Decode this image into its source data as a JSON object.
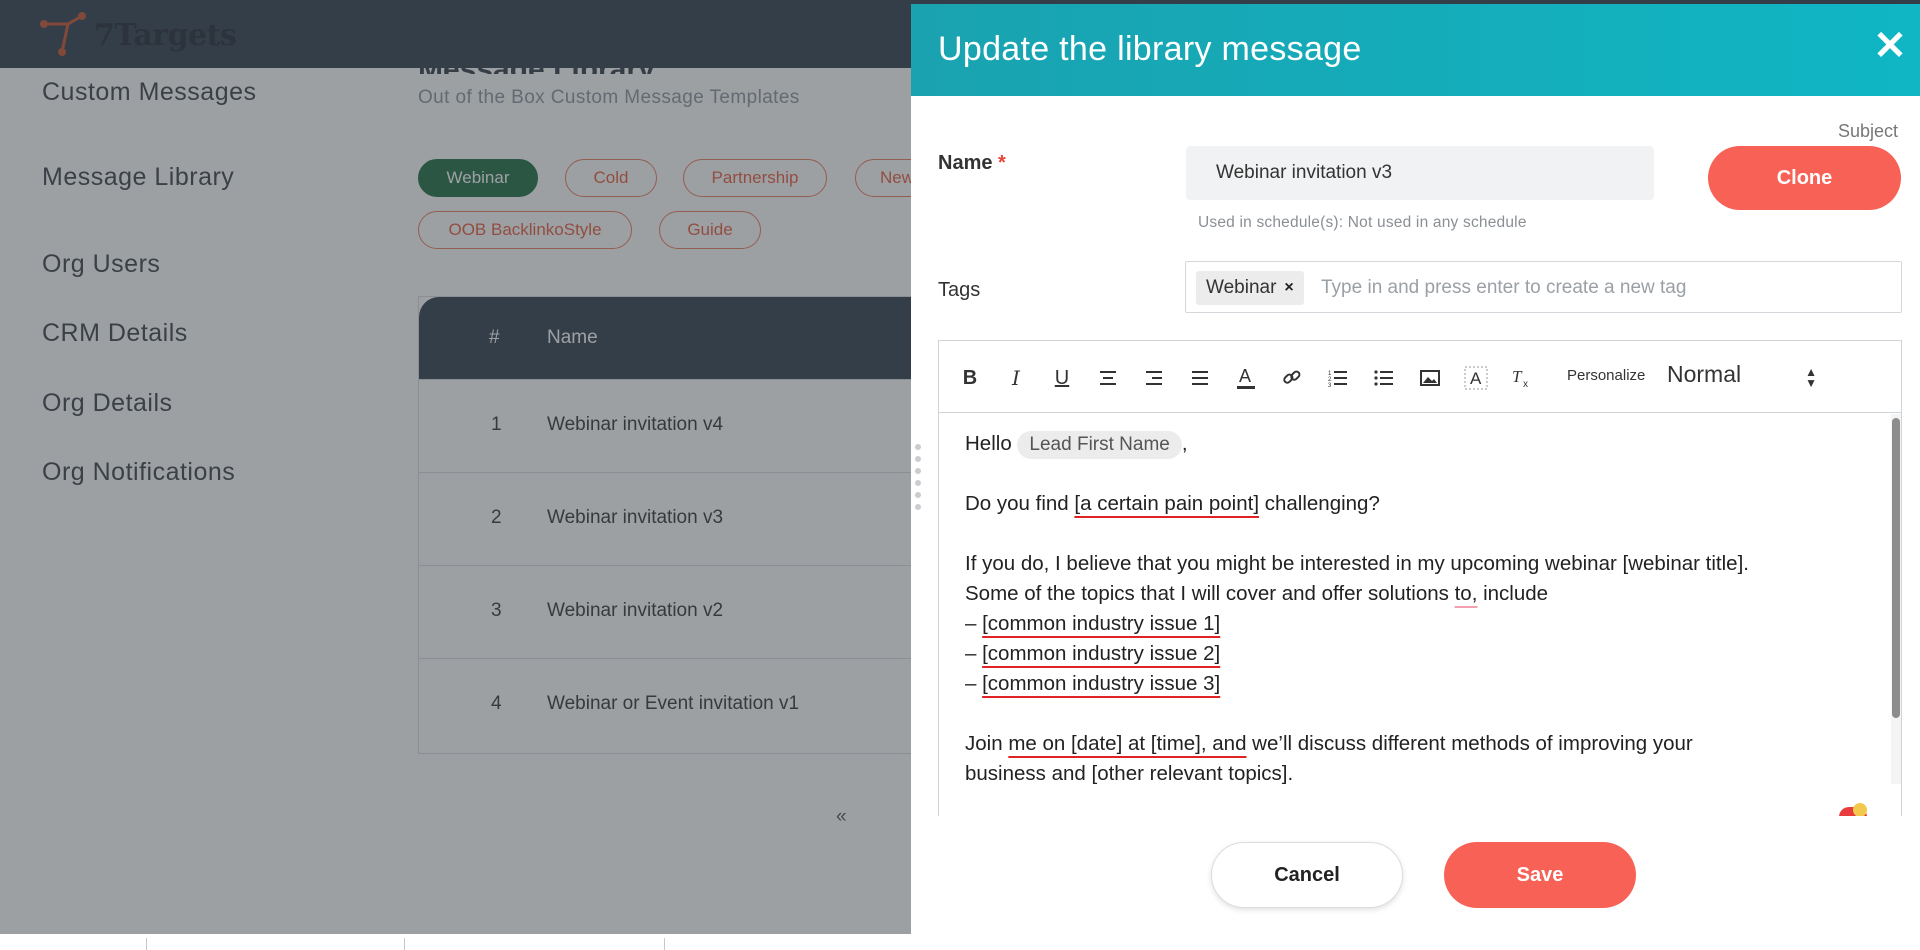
{
  "app": {
    "logo_text": "7Targets",
    "page_heading": "Message Library",
    "page_subtitle": "Out of the Box Custom Message Templates"
  },
  "sidebar": {
    "items": [
      {
        "label": "Custom Messages"
      },
      {
        "label": "Message Library"
      },
      {
        "label": "Org Users"
      },
      {
        "label": "CRM Details"
      },
      {
        "label": "Org Details"
      },
      {
        "label": "Org Notifications"
      }
    ]
  },
  "filters": {
    "chips": [
      {
        "label": "Webinar",
        "active": true
      },
      {
        "label": "Cold",
        "active": false
      },
      {
        "label": "Partnership",
        "active": false
      },
      {
        "label": "New",
        "active": false
      },
      {
        "label": "OOB BacklinkoStyle",
        "active": false
      },
      {
        "label": "Guide",
        "active": false
      }
    ]
  },
  "table": {
    "headers": {
      "num": "#",
      "name": "Name"
    },
    "rows": [
      {
        "num": "1",
        "name": "Webinar invitation v4"
      },
      {
        "num": "2",
        "name": "Webinar invitation v3"
      },
      {
        "num": "3",
        "name": "Webinar invitation v2"
      },
      {
        "num": "4",
        "name": "Webinar or Event invitation v1"
      }
    ],
    "pager_prev": "«"
  },
  "modal": {
    "title": "Update the library message",
    "close_glyph": "✕",
    "name_label": "Name",
    "required_mark": "*",
    "subject_label": "Subject",
    "name_value": "Webinar invitation v3",
    "clone_label": "Clone",
    "used_in_text": "Used in schedule(s): Not used in any schedule",
    "tags_label": "Tags",
    "tags": [
      {
        "label": "Webinar",
        "remove_glyph": "×"
      }
    ],
    "tag_placeholder": "Type in and press enter to create a new tag",
    "toolbar": {
      "personalize_label": "Personalize",
      "format_value": "Normal"
    },
    "body": {
      "greeting": "Hello",
      "merge_field": "Lead First Name",
      "greeting_comma": ",",
      "q_before": "Do you find ",
      "q_marked": "[a certain pain point]",
      "q_after": " challenging?",
      "p1": "If you do, I believe that you might be interested in my upcoming webinar [webinar title].",
      "p2_before": "Some of the topics that I will cover and offer solutions ",
      "p2_marked": "to,",
      "p2_after": " include",
      "dash": "– ",
      "issues": [
        "[common industry issue 1]",
        "[common industry issue 2]",
        "[common industry issue 3]"
      ],
      "j_before": "Join ",
      "j_marked": "me on [date] at [time], and",
      "j_after": " we’ll discuss different methods of improving your",
      "j2": "business and [other relevant topics]."
    },
    "cancel_label": "Cancel",
    "save_label": "Save"
  },
  "colors": {
    "header_teal": "#1aa2b0",
    "accent_coral": "#f76156",
    "active_chip_green": "#1a6a40",
    "nav_dark": "#2b3a4a"
  }
}
